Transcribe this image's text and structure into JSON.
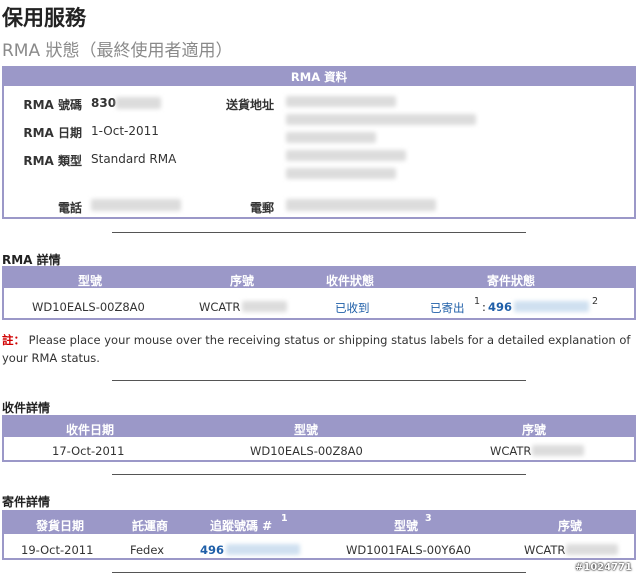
{
  "page": {
    "title": "保用服務",
    "subtitle": "RMA 狀態（最終使用者適用）"
  },
  "rma_info": {
    "header": "RMA 資料",
    "rma_number_label": "RMA 號碼",
    "rma_number_value": "830",
    "rma_date_label": "RMA 日期",
    "rma_date_value": "1-Oct-2011",
    "rma_type_label": "RMA 類型",
    "rma_type_value": "Standard RMA",
    "phone_label": "電話",
    "address_label": "送貨地址",
    "email_label": "電郵"
  },
  "rma_details": {
    "section_title": "RMA 詳情",
    "columns": [
      "型號",
      "序號",
      "收件狀態",
      "寄件狀態"
    ],
    "row": {
      "model": "WD10EALS-00Z8A0",
      "serial": "WCATR",
      "receive_status": "已收到",
      "ship_status": "已寄出",
      "ship_sup1": "1",
      "tracking": "496",
      "sup2": "2"
    }
  },
  "note": {
    "prefix": "註：",
    "text": "Please place your mouse over the receiving status or shipping status labels for a detailed explanation of your RMA status."
  },
  "receive_details": {
    "section_title": "收件詳情",
    "columns": [
      "收件日期",
      "型號",
      "序號"
    ],
    "row": {
      "date": "17-Oct-2011",
      "model": "WD10EALS-00Z8A0",
      "serial": "WCATR"
    }
  },
  "ship_details": {
    "section_title": "寄件詳情",
    "columns": [
      "發貨日期",
      "託運商",
      "追蹤號碼 #",
      "型號",
      "序號"
    ],
    "sup_tracking": "1",
    "sup_model": "3",
    "row": {
      "date": "19-Oct-2011",
      "carrier": "Fedex",
      "tracking": "496",
      "model": "WD1001FALS-00Y6A0",
      "serial": "WCATR"
    }
  },
  "watermark": "#1024771"
}
